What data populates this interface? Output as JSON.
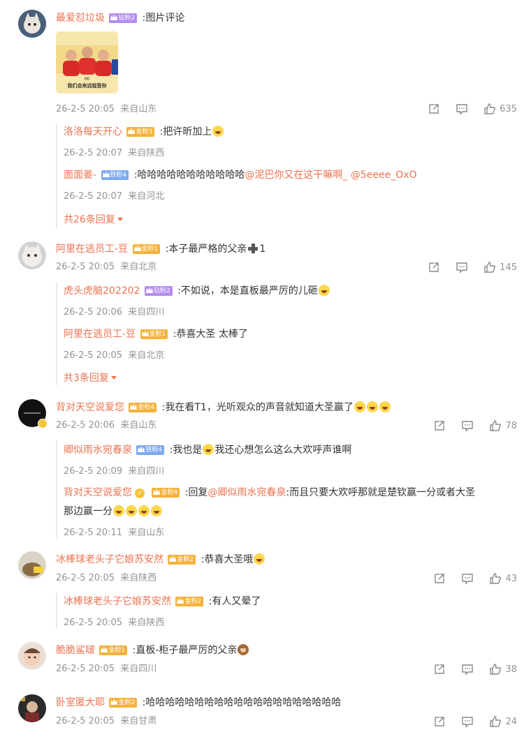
{
  "colors": {
    "username": "#eb7350",
    "meta": "#939393",
    "text": "#333333",
    "divider": "#e9e9e9"
  },
  "icons": {
    "share": "share-icon",
    "comment": "comment-icon",
    "like": "like-icon"
  },
  "comments": [
    {
      "user": "最爱怼垃圾",
      "badge": "钻粉2",
      "text": ":图片评论",
      "picture_caption_1": "Hi",
      "picture_caption_2": "我们会来远程签你",
      "time": "26-2-5 20:05",
      "location": "来自山东",
      "likes": "635",
      "replies": [
        {
          "user": "洛洛每天开心",
          "badge": "金粉3",
          "text": ":把许昕加上",
          "time": "26-2-5 20:07",
          "location": "来自陕西"
        },
        {
          "user": "面面姜-",
          "badge": "铁粉4",
          "text": ":哈哈哈哈哈哈哈哈哈哈哈",
          "mention1": "@泥巴你又在这干嘛啊_",
          "mention2": "@5eeee_OxO",
          "time": "26-2-5 20:07",
          "location": "来自河北"
        }
      ],
      "more": "共26条回复"
    },
    {
      "user": "阿里在逃员工-豆",
      "badge": "金粉1",
      "text": ":本子最严格的父亲",
      "text_tail": "1",
      "time": "26-2-5 20:05",
      "location": "来自北京",
      "likes": "145",
      "replies": [
        {
          "user": "虎头虎脑202202",
          "badge": "钻粉2",
          "text": ":不如说，本是直板最严厉的儿砸",
          "time": "26-2-5 20:06",
          "location": "来自四川"
        },
        {
          "user": "阿里在逃员工-豆",
          "badge": "金粉1",
          "text": ":恭喜大圣 太棒了",
          "time": "26-2-5 20:05",
          "location": "来自北京"
        }
      ],
      "more": "共3条回复"
    },
    {
      "user": "背对天空说爱您",
      "badge": "金粉4",
      "text": ":我在看T1，光听观众的声音就知道大圣赢了",
      "time": "26-2-5 20:06",
      "location": "来自山东",
      "likes": "78",
      "replies": [
        {
          "user": "卿似雨水宛春泉",
          "badge": "铁粉4",
          "text": ":我也是",
          "text2": "我还心想怎么这么大欢呼声谁啊",
          "time": "26-2-5 20:09",
          "location": "来自四川"
        },
        {
          "user": "背对天空说爱您",
          "badge": "金粉4",
          "text": ":回复",
          "mention1": "@卿似雨水宛春泉",
          "text2": ":而且只要大欢呼那就是楚钦赢一分或者大圣",
          "text3": "那边赢一分",
          "time": "26-2-5 20:11",
          "location": "来自山东"
        }
      ]
    },
    {
      "user": "冰棒球老头子它娘苏安然",
      "badge": "金粉2",
      "text": ":恭喜大圣哦",
      "time": "26-2-5 20:05",
      "location": "来自陕西",
      "likes": "43",
      "replies": [
        {
          "user": "冰棒球老头子它娘苏安然",
          "badge": "金粉2",
          "text": ":有人又晕了",
          "time": "26-2-5 20:05",
          "location": "来自陕西"
        }
      ]
    },
    {
      "user": "脆脆鲨啵",
      "badge": "金粉1",
      "text": ":直板-柜子最严厉的父亲",
      "time": "26-2-5 20:05",
      "location": "来自四川",
      "likes": "38"
    },
    {
      "user": "卧室匿大耶",
      "badge": "金粉2",
      "text": ":哈哈哈哈哈哈哈哈哈哈哈哈哈哈哈哈哈哈哈哈",
      "time": "26-2-5 20:05",
      "location": "来自甘肃",
      "likes": "24"
    }
  ]
}
